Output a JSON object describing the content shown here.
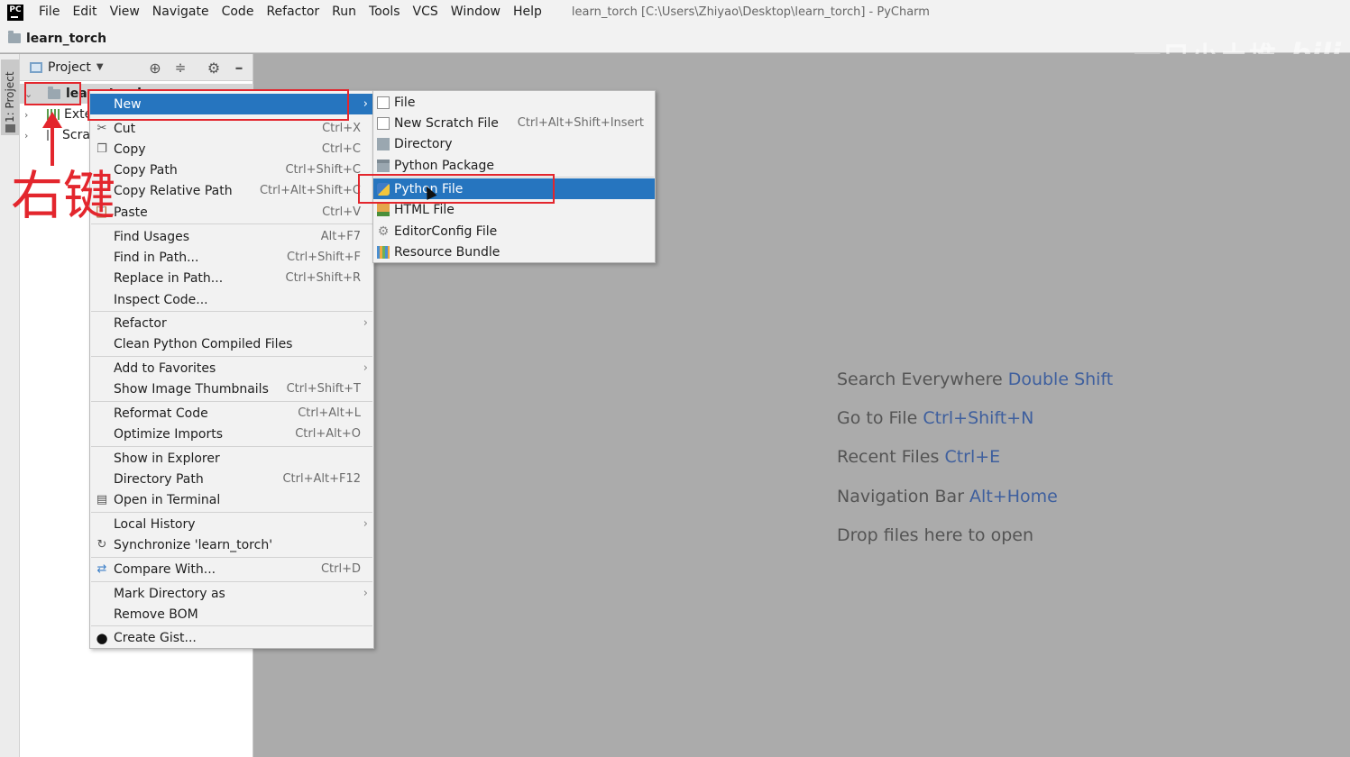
{
  "menubar": {
    "logo": "PC",
    "items": [
      "File",
      "Edit",
      "View",
      "Navigate",
      "Code",
      "Refactor",
      "Run",
      "Tools",
      "VCS",
      "Window",
      "Help"
    ],
    "title": "learn_torch [C:\\Users\\Zhiyao\\Desktop\\learn_torch] - PyCharm"
  },
  "navbar": {
    "project": "learn_torch"
  },
  "watermark": {
    "text": "一只小土堆",
    "logo": "bili"
  },
  "left_stripe": {
    "project_tool": "1: Project"
  },
  "project_panel": {
    "title": "Project",
    "tree": [
      {
        "label": "learn_torch",
        "expanded": true,
        "selected": true
      },
      {
        "label": "External Libraries",
        "expanded": false
      },
      {
        "label": "Scratches and Consoles",
        "expanded": false
      }
    ]
  },
  "context_menu": {
    "items": [
      {
        "label": "New",
        "shortcut": "",
        "submenu": true,
        "highlighted": true,
        "icon": ""
      },
      {
        "label": "Cut",
        "shortcut": "Ctrl+X",
        "icon": "scissors-icon"
      },
      {
        "label": "Copy",
        "shortcut": "Ctrl+C",
        "icon": "copy-icon"
      },
      {
        "label": "Copy Path",
        "shortcut": "Ctrl+Shift+C"
      },
      {
        "label": "Copy Relative Path",
        "shortcut": "Ctrl+Alt+Shift+C"
      },
      {
        "label": "Paste",
        "shortcut": "Ctrl+V",
        "icon": "paste-icon"
      },
      {
        "label": "Find Usages",
        "shortcut": "Alt+F7"
      },
      {
        "label": "Find in Path...",
        "shortcut": "Ctrl+Shift+F"
      },
      {
        "label": "Replace in Path...",
        "shortcut": "Ctrl+Shift+R"
      },
      {
        "label": "Inspect Code...",
        "shortcut": ""
      },
      {
        "label": "Refactor",
        "shortcut": "",
        "submenu": true
      },
      {
        "label": "Clean Python Compiled Files",
        "shortcut": ""
      },
      {
        "label": "Add to Favorites",
        "shortcut": "",
        "submenu": true
      },
      {
        "label": "Show Image Thumbnails",
        "shortcut": "Ctrl+Shift+T"
      },
      {
        "label": "Reformat Code",
        "shortcut": "Ctrl+Alt+L"
      },
      {
        "label": "Optimize Imports",
        "shortcut": "Ctrl+Alt+O"
      },
      {
        "label": "Show in Explorer",
        "shortcut": ""
      },
      {
        "label": "Directory Path",
        "shortcut": "Ctrl+Alt+F12"
      },
      {
        "label": "Open in Terminal",
        "shortcut": "",
        "icon": "terminal-icon"
      },
      {
        "label": "Local History",
        "shortcut": "",
        "submenu": true
      },
      {
        "label": "Synchronize 'learn_torch'",
        "shortcut": "",
        "icon": "sync-icon"
      },
      {
        "label": "Compare With...",
        "shortcut": "Ctrl+D",
        "icon": "compare-icon"
      },
      {
        "label": "Mark Directory as",
        "shortcut": "",
        "submenu": true
      },
      {
        "label": "Remove BOM",
        "shortcut": ""
      },
      {
        "label": "Create Gist...",
        "shortcut": "",
        "icon": "github-icon"
      }
    ]
  },
  "submenu": {
    "items": [
      {
        "label": "File",
        "shortcut": "",
        "icon": "file-icon"
      },
      {
        "label": "New Scratch File",
        "shortcut": "Ctrl+Alt+Shift+Insert",
        "icon": "scratch-file-icon"
      },
      {
        "label": "Directory",
        "shortcut": "",
        "icon": "directory-icon"
      },
      {
        "label": "Python Package",
        "shortcut": "",
        "icon": "python-package-icon"
      },
      {
        "label": "Python File",
        "shortcut": "",
        "icon": "python-file-icon",
        "highlighted": true
      },
      {
        "label": "HTML File",
        "shortcut": "",
        "icon": "html-file-icon"
      },
      {
        "label": "EditorConfig File",
        "shortcut": "",
        "icon": "editorconfig-icon"
      },
      {
        "label": "Resource Bundle",
        "shortcut": "",
        "icon": "resource-bundle-icon"
      }
    ]
  },
  "editor_hints": [
    {
      "text": "Search Everywhere ",
      "key": "Double Shift"
    },
    {
      "text": "Go to File ",
      "key": "Ctrl+Shift+N"
    },
    {
      "text": "Recent Files ",
      "key": "Ctrl+E"
    },
    {
      "text": "Navigation Bar ",
      "key": "Alt+Home"
    },
    {
      "text": "Drop files here to open",
      "key": ""
    }
  ],
  "annotation": {
    "text": "右键"
  },
  "colors": {
    "highlight": "#2675bf",
    "annotation_red": "#e3262d",
    "hint_key": "#3e5f9e"
  }
}
